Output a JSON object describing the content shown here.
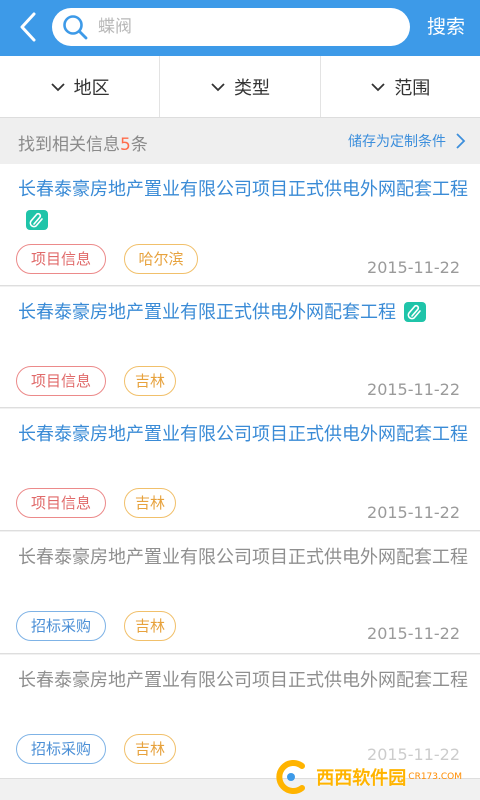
{
  "header": {
    "search_placeholder": "蝶阀",
    "search_button": "搜索"
  },
  "filters": [
    {
      "label": "地区"
    },
    {
      "label": "类型"
    },
    {
      "label": "范围"
    }
  ],
  "result_bar": {
    "prefix": "找到相关信息",
    "count": "5",
    "suffix": "条",
    "save_label": "储存为定制条件"
  },
  "items": [
    {
      "title": "长春泰豪房地产置业有限公司项目正式供电外网配套工程",
      "attachment": true,
      "tags": [
        "项目信息",
        "哈尔滨"
      ],
      "date": "2015-11-22"
    },
    {
      "title": "长春泰豪房地产置业有限正式供电外网配套工程",
      "attachment": true,
      "tags": [
        "项目信息",
        "吉林"
      ],
      "date": "2015-11-22"
    },
    {
      "title": "长春泰豪房地产置业有限公司项目正式供电外网配套工程",
      "attachment": false,
      "tags": [
        "项目信息",
        "吉林"
      ],
      "date": "2015-11-22"
    },
    {
      "title": "长春泰豪房地产置业有限公司项目正式供电外网配套工程",
      "attachment": false,
      "tags": [
        "招标采购",
        "吉林"
      ],
      "date": "2015-11-22"
    },
    {
      "title": "长春泰豪房地产置业有限公司项目正式供电外网配套工程",
      "attachment": false,
      "tags": [
        "招标采购",
        "吉林"
      ],
      "date": "2015-11-22"
    }
  ],
  "watermark": {
    "text": "西西软件园",
    "sub": "CR173.COM"
  },
  "colors": {
    "header": "#3d9ae8",
    "count": "#ff6b4a",
    "title_blue": "#3a8bd6",
    "attachment": "#1fc4a9"
  }
}
